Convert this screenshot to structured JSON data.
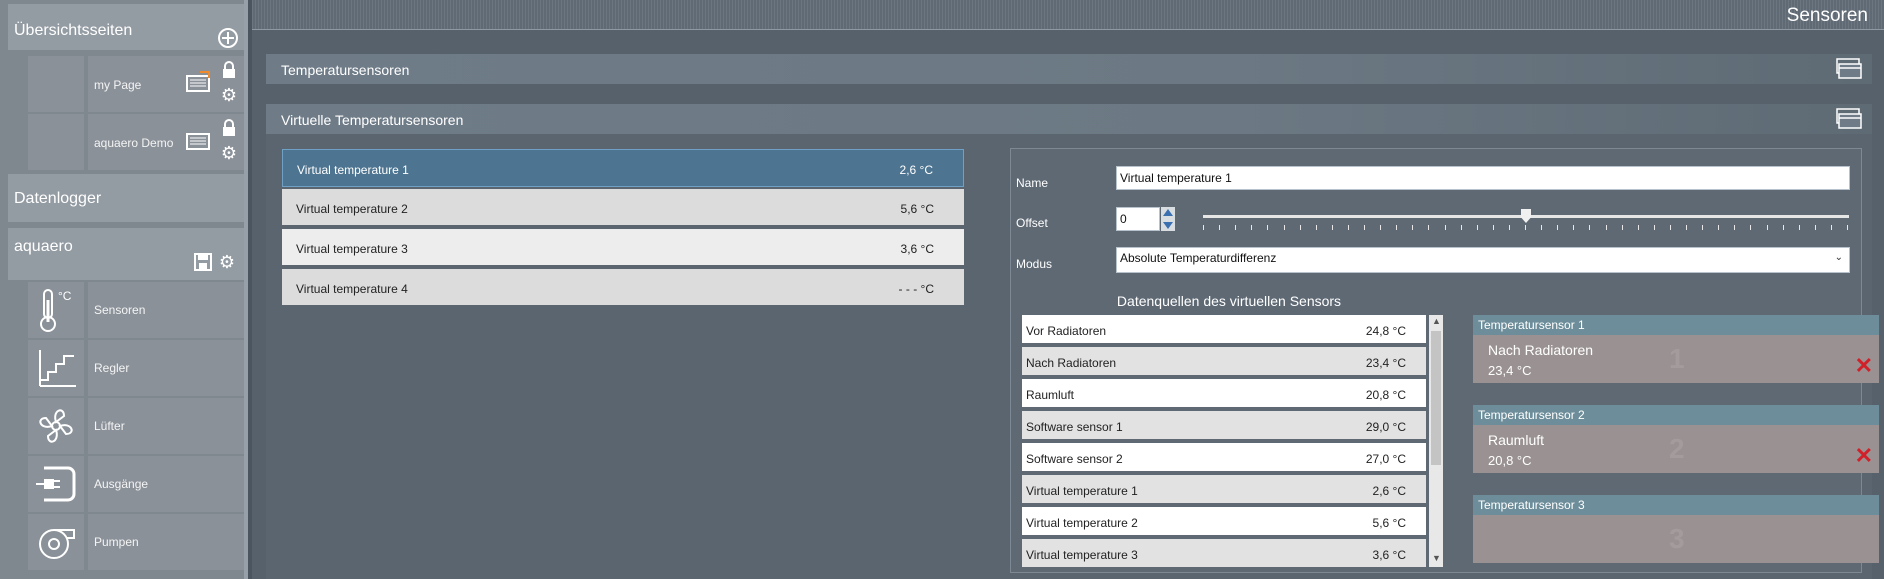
{
  "sidebar": {
    "overview_title": "Übersichtsseiten",
    "pages": [
      {
        "label": "my Page"
      },
      {
        "label": "aquaero Demo"
      }
    ],
    "datalogger_title": "Datenlogger",
    "device_title": "aquaero",
    "nav": [
      {
        "label": "Sensoren",
        "icon": "thermometer-icon",
        "extra": "°C"
      },
      {
        "label": "Regler",
        "icon": "controller-icon"
      },
      {
        "label": "Lüfter",
        "icon": "fan-icon"
      },
      {
        "label": "Ausgänge",
        "icon": "plug-icon"
      },
      {
        "label": "Pumpen",
        "icon": "pump-icon"
      }
    ]
  },
  "header": {
    "title": "Sensoren"
  },
  "sections": {
    "temp_sensors": "Temperatursensoren",
    "virtual_sensors": "Virtuelle Temperatursensoren"
  },
  "virtual_list": [
    {
      "name": "Virtual temperature 1",
      "value": "2,6 °C",
      "selected": true
    },
    {
      "name": "Virtual temperature 2",
      "value": "5,6 °C"
    },
    {
      "name": "Virtual temperature 3",
      "value": "3,6 °C"
    },
    {
      "name": "Virtual temperature 4",
      "value": "- - - °C"
    }
  ],
  "detail": {
    "name_label": "Name",
    "name_value": "Virtual temperature 1",
    "offset_label": "Offset",
    "offset_value": "0",
    "offset_slider_position": 0.5,
    "mode_label": "Modus",
    "mode_value": "Absolute Temperaturdifferenz",
    "sources_title": "Datenquellen des virtuellen Sensors"
  },
  "data_sources": [
    {
      "name": "Vor Radiatoren",
      "value": "24,8 °C"
    },
    {
      "name": "Nach Radiatoren",
      "value": "23,4 °C"
    },
    {
      "name": "Raumluft",
      "value": "20,8 °C"
    },
    {
      "name": "Software sensor 1",
      "value": "29,0 °C"
    },
    {
      "name": "Software sensor 2",
      "value": "27,0 °C"
    },
    {
      "name": "Virtual temperature 1",
      "value": "2,6 °C"
    },
    {
      "name": "Virtual temperature 2",
      "value": "5,6 °C"
    },
    {
      "name": "Virtual temperature 3",
      "value": "3,6 °C"
    }
  ],
  "slots": [
    {
      "header": "Temperatursensor 1",
      "name": "Nach Radiatoren",
      "value": "23,4 °C",
      "num": "1"
    },
    {
      "header": "Temperatursensor 2",
      "name": "Raumluft",
      "value": "20,8 °C",
      "num": "2"
    },
    {
      "header": "Temperatursensor 3",
      "name": "",
      "value": "",
      "num": "3"
    }
  ],
  "colors": {
    "accent_selected": "#4d7491",
    "remove": "#d0202a",
    "slot_header": "#6c8d99"
  }
}
